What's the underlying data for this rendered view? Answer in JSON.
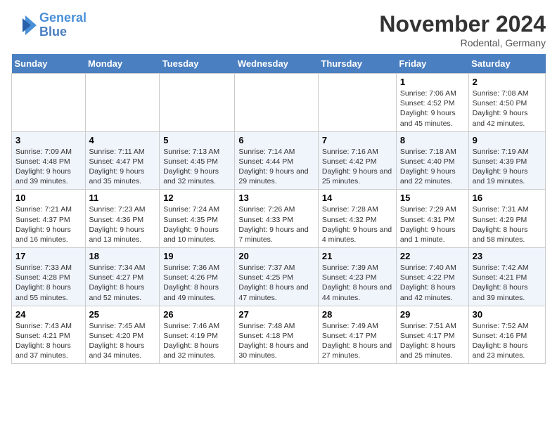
{
  "header": {
    "logo_line1": "General",
    "logo_line2": "Blue",
    "month": "November 2024",
    "location": "Rodental, Germany"
  },
  "weekdays": [
    "Sunday",
    "Monday",
    "Tuesday",
    "Wednesday",
    "Thursday",
    "Friday",
    "Saturday"
  ],
  "weeks": [
    [
      {
        "day": "",
        "info": ""
      },
      {
        "day": "",
        "info": ""
      },
      {
        "day": "",
        "info": ""
      },
      {
        "day": "",
        "info": ""
      },
      {
        "day": "",
        "info": ""
      },
      {
        "day": "1",
        "info": "Sunrise: 7:06 AM\nSunset: 4:52 PM\nDaylight: 9 hours and 45 minutes."
      },
      {
        "day": "2",
        "info": "Sunrise: 7:08 AM\nSunset: 4:50 PM\nDaylight: 9 hours and 42 minutes."
      }
    ],
    [
      {
        "day": "3",
        "info": "Sunrise: 7:09 AM\nSunset: 4:48 PM\nDaylight: 9 hours and 39 minutes."
      },
      {
        "day": "4",
        "info": "Sunrise: 7:11 AM\nSunset: 4:47 PM\nDaylight: 9 hours and 35 minutes."
      },
      {
        "day": "5",
        "info": "Sunrise: 7:13 AM\nSunset: 4:45 PM\nDaylight: 9 hours and 32 minutes."
      },
      {
        "day": "6",
        "info": "Sunrise: 7:14 AM\nSunset: 4:44 PM\nDaylight: 9 hours and 29 minutes."
      },
      {
        "day": "7",
        "info": "Sunrise: 7:16 AM\nSunset: 4:42 PM\nDaylight: 9 hours and 25 minutes."
      },
      {
        "day": "8",
        "info": "Sunrise: 7:18 AM\nSunset: 4:40 PM\nDaylight: 9 hours and 22 minutes."
      },
      {
        "day": "9",
        "info": "Sunrise: 7:19 AM\nSunset: 4:39 PM\nDaylight: 9 hours and 19 minutes."
      }
    ],
    [
      {
        "day": "10",
        "info": "Sunrise: 7:21 AM\nSunset: 4:37 PM\nDaylight: 9 hours and 16 minutes."
      },
      {
        "day": "11",
        "info": "Sunrise: 7:23 AM\nSunset: 4:36 PM\nDaylight: 9 hours and 13 minutes."
      },
      {
        "day": "12",
        "info": "Sunrise: 7:24 AM\nSunset: 4:35 PM\nDaylight: 9 hours and 10 minutes."
      },
      {
        "day": "13",
        "info": "Sunrise: 7:26 AM\nSunset: 4:33 PM\nDaylight: 9 hours and 7 minutes."
      },
      {
        "day": "14",
        "info": "Sunrise: 7:28 AM\nSunset: 4:32 PM\nDaylight: 9 hours and 4 minutes."
      },
      {
        "day": "15",
        "info": "Sunrise: 7:29 AM\nSunset: 4:31 PM\nDaylight: 9 hours and 1 minute."
      },
      {
        "day": "16",
        "info": "Sunrise: 7:31 AM\nSunset: 4:29 PM\nDaylight: 8 hours and 58 minutes."
      }
    ],
    [
      {
        "day": "17",
        "info": "Sunrise: 7:33 AM\nSunset: 4:28 PM\nDaylight: 8 hours and 55 minutes."
      },
      {
        "day": "18",
        "info": "Sunrise: 7:34 AM\nSunset: 4:27 PM\nDaylight: 8 hours and 52 minutes."
      },
      {
        "day": "19",
        "info": "Sunrise: 7:36 AM\nSunset: 4:26 PM\nDaylight: 8 hours and 49 minutes."
      },
      {
        "day": "20",
        "info": "Sunrise: 7:37 AM\nSunset: 4:25 PM\nDaylight: 8 hours and 47 minutes."
      },
      {
        "day": "21",
        "info": "Sunrise: 7:39 AM\nSunset: 4:23 PM\nDaylight: 8 hours and 44 minutes."
      },
      {
        "day": "22",
        "info": "Sunrise: 7:40 AM\nSunset: 4:22 PM\nDaylight: 8 hours and 42 minutes."
      },
      {
        "day": "23",
        "info": "Sunrise: 7:42 AM\nSunset: 4:21 PM\nDaylight: 8 hours and 39 minutes."
      }
    ],
    [
      {
        "day": "24",
        "info": "Sunrise: 7:43 AM\nSunset: 4:21 PM\nDaylight: 8 hours and 37 minutes."
      },
      {
        "day": "25",
        "info": "Sunrise: 7:45 AM\nSunset: 4:20 PM\nDaylight: 8 hours and 34 minutes."
      },
      {
        "day": "26",
        "info": "Sunrise: 7:46 AM\nSunset: 4:19 PM\nDaylight: 8 hours and 32 minutes."
      },
      {
        "day": "27",
        "info": "Sunrise: 7:48 AM\nSunset: 4:18 PM\nDaylight: 8 hours and 30 minutes."
      },
      {
        "day": "28",
        "info": "Sunrise: 7:49 AM\nSunset: 4:17 PM\nDaylight: 8 hours and 27 minutes."
      },
      {
        "day": "29",
        "info": "Sunrise: 7:51 AM\nSunset: 4:17 PM\nDaylight: 8 hours and 25 minutes."
      },
      {
        "day": "30",
        "info": "Sunrise: 7:52 AM\nSunset: 4:16 PM\nDaylight: 8 hours and 23 minutes."
      }
    ]
  ]
}
